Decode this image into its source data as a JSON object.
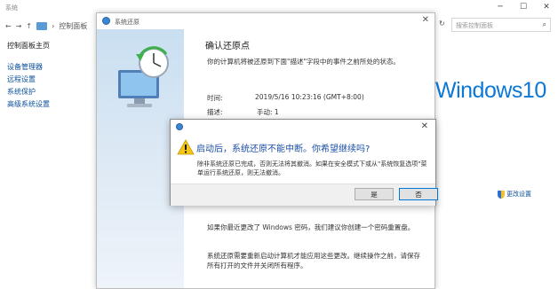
{
  "control_panel": {
    "title": "系统",
    "nav_path": "控制面板",
    "search_placeholder": "搜索控制面板",
    "sidebar_home": "控制面板主页",
    "sidebar_items": [
      {
        "label": "设备管理器"
      },
      {
        "label": "远程设置"
      },
      {
        "label": "系统保护"
      },
      {
        "label": "高级系统设置"
      }
    ],
    "logo_text": "Windows10",
    "change_settings": "更改设置"
  },
  "system_restore": {
    "title": "系统还原",
    "heading": "确认还原点",
    "description": "你的计算机将被还原到下面\"描述\"字段中的事件之前所处的状态。",
    "time_label": "时间:",
    "time_value": "2019/5/16 10:23:16 (GMT+8:00)",
    "desc_label": "描述:",
    "desc_value": "手动: 1",
    "password_note": "如果你最近更改了 Windows 密码，我们建议你创建一个密码重置盘。",
    "save_note": "系统还原需要重新启动计算机才能应用这些更改。继续操作之前，请保存所有打开的文件并关闭所有程序。"
  },
  "dialog": {
    "question": "启动后，系统还原不能中断。你希望继续吗?",
    "info": "除非系统还原已完成，否则无法将其撤消。如果在安全模式下或从\"系统恢复选项\"菜单运行系统还原，则无法撤消。",
    "yes_label": "是",
    "no_label": "否"
  },
  "colors": {
    "accent": "#0b78d7",
    "link": "#0b4f9c",
    "dialog_question": "#1b4ea3",
    "warning": "#f5c518"
  }
}
